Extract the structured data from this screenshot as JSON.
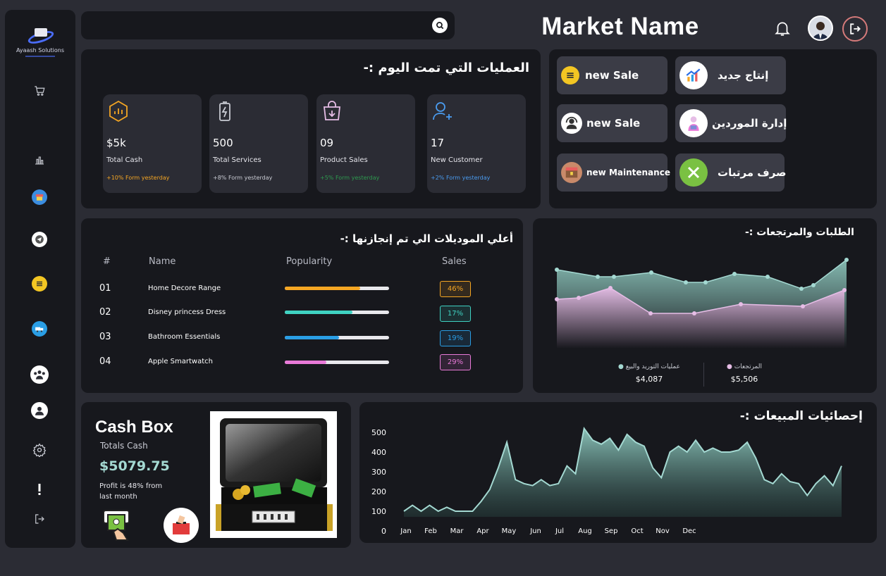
{
  "sidebar": {
    "logo_text": "Ayaash Solutions",
    "items": [
      "cart",
      "bar-chart",
      "store",
      "telegram",
      "sale",
      "delivery",
      "team",
      "user",
      "settings",
      "alert",
      "logout"
    ]
  },
  "header": {
    "search_placeholder": "",
    "market_name": "Market Name"
  },
  "operations": {
    "title": "العمليات التي تمت اليوم :-",
    "cards": [
      {
        "icon": "bar-chart-icon",
        "value": "$5k",
        "label": "Total Cash",
        "change": "+10% Form yesterday",
        "color": "#f5a623"
      },
      {
        "icon": "battery-charge-icon",
        "value": "500",
        "label": "Total Services",
        "change": "+8% Form yesterday",
        "color": "#c9cbd3"
      },
      {
        "icon": "shopping-bag-icon",
        "value": "09",
        "label": "Product Sales",
        "change": "+5% Form yesterday",
        "color": "#2e9a4f"
      },
      {
        "icon": "add-user-icon",
        "value": "17",
        "label": "New Customer",
        "change": "+2% Form yesterday",
        "color": "#4a9cf0"
      }
    ]
  },
  "quick_actions": [
    {
      "label": "new Sale",
      "icon": "sale-icon"
    },
    {
      "label": "إنتاج جديد",
      "icon": "growth-chart-icon"
    },
    {
      "label": "new Sale",
      "icon": "support-icon"
    },
    {
      "label": "إدارة الموردين",
      "icon": "supplier-icon"
    },
    {
      "label": "new Maintenance",
      "icon": "maintenance-icon"
    },
    {
      "label": "صرف مرتبات",
      "icon": "tools-icon"
    }
  ],
  "top_models": {
    "title": "أعلي الموديلات الي تم إنجازنها :-",
    "headers": [
      "#",
      "Name",
      "Popularity",
      "Sales"
    ],
    "rows": [
      {
        "num": "01",
        "name": "Home Decore Range",
        "popularity": 0.72,
        "sales": "46%",
        "color": "#f5a623"
      },
      {
        "num": "02",
        "name": "Disney princess Dress",
        "popularity": 0.65,
        "sales": "17%",
        "color": "#3fd2c2"
      },
      {
        "num": "03",
        "name": "Bathroom Essentials",
        "popularity": 0.52,
        "sales": "19%",
        "color": "#2a9ee5"
      },
      {
        "num": "04",
        "name": "Apple Smartwatch",
        "popularity": 0.4,
        "sales": "29%",
        "color": "#e97ad8"
      }
    ]
  },
  "orders": {
    "title": "الطلبات والمرتجعات :-",
    "legend": [
      {
        "label": "عمليات التوريد والبيع",
        "value": "$4,087",
        "color": "#a4d9d2"
      },
      {
        "label": "المرتجعات",
        "value": "$5,506",
        "color": "#e6bde6"
      }
    ]
  },
  "cashbox": {
    "title": "Cash Box",
    "subtitle": "Totals Cash",
    "value": "$5079.75",
    "profit": "Profit is 48% from last month"
  },
  "sales_stats": {
    "title": "إحصائيات المبيعات :-"
  },
  "chart_data": [
    {
      "type": "area",
      "title": "الطلبات والمرتجعات :-",
      "x": [
        1,
        2,
        3,
        4,
        5,
        6,
        7,
        8,
        9,
        10,
        11,
        12,
        13,
        14
      ],
      "series": [
        {
          "name": "عمليات التوريد والبيع",
          "values": [
            82,
            72,
            72,
            78,
            64,
            64,
            76,
            72,
            55,
            60,
            96,
            0,
            0,
            0
          ]
        },
        {
          "name": "المرتجعات",
          "values": [
            40,
            42,
            56,
            20,
            20,
            33,
            30,
            53,
            0,
            0,
            0,
            0,
            0,
            0
          ]
        }
      ]
    },
    {
      "type": "area",
      "title": "إحصائيات المبيعات :-",
      "categories": [
        "Jan",
        "Feb",
        "Mar",
        "Apr",
        "May",
        "Jun",
        "Jul",
        "Aug",
        "Sep",
        "Oct",
        "Nov",
        "Dec"
      ],
      "yticks": [
        0,
        100,
        200,
        300,
        400,
        500
      ],
      "ylim": [
        0,
        500
      ],
      "values": [
        100,
        130,
        100,
        130,
        100,
        120,
        100,
        100,
        100,
        150,
        210,
        320,
        450,
        260,
        240,
        230,
        260,
        230,
        240,
        330,
        290,
        520,
        460,
        440,
        470,
        410,
        490,
        450,
        430,
        320,
        270,
        400,
        430,
        400,
        460,
        400,
        420,
        400,
        400,
        410,
        450,
        370,
        260,
        240,
        290,
        250,
        240,
        180,
        240,
        280,
        230,
        330
      ]
    }
  ]
}
